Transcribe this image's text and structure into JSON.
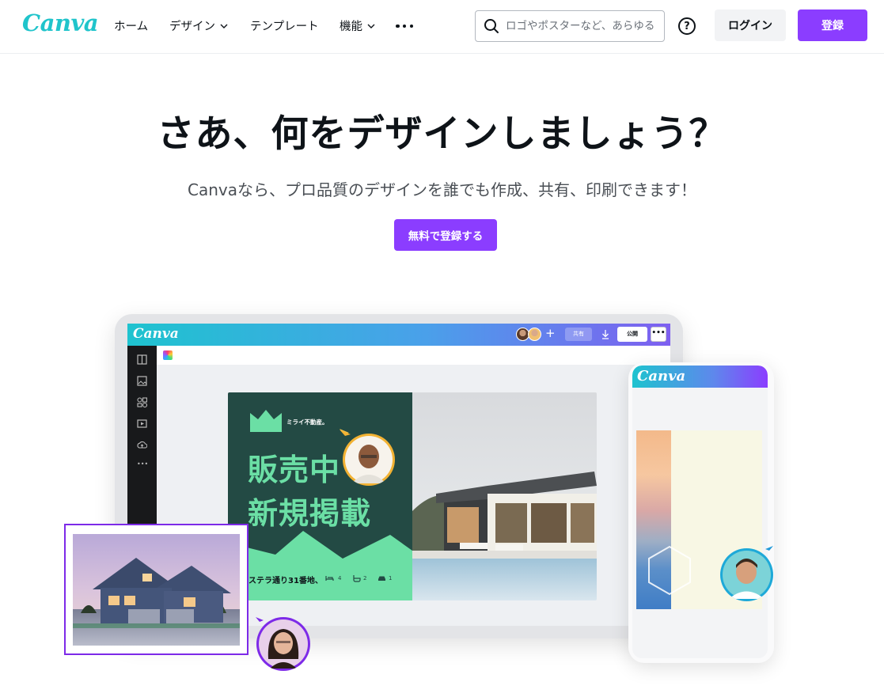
{
  "header": {
    "logo": "Canva",
    "nav": [
      {
        "label": "ホーム"
      },
      {
        "label": "デザイン"
      },
      {
        "label": "テンプレート"
      },
      {
        "label": "機能"
      }
    ],
    "search_placeholder": "ロゴやポスターなど、あらゆる",
    "help_label": "?",
    "login_label": "ログイン",
    "signup_label": "登録"
  },
  "hero": {
    "title": "さあ、何をデザインしましょう？",
    "subtitle": "Canvaなら、プロ品質のデザインを誰でも作成、共有、印刷できます！",
    "cta_label": "無料で登録する"
  },
  "editor": {
    "logo": "Canva",
    "plus": "+",
    "share_label": "共有",
    "publish_label": "公開",
    "more_label": "•••",
    "side_more": "•••",
    "design": {
      "brand_name": "ミライ不動産。",
      "line1": "販売中",
      "line2": "新規掲載",
      "address": "ステラ通り31番地、",
      "bed_count": "4",
      "bath_count": "2",
      "car_count": "1"
    }
  },
  "phone": {
    "logo": "Canva"
  },
  "colors": {
    "accent": "#8b3dff",
    "brand_teal": "#20c4cb",
    "design_green": "#234a44",
    "design_mint": "#6bdfa5",
    "selection": "#7d2ae8"
  }
}
